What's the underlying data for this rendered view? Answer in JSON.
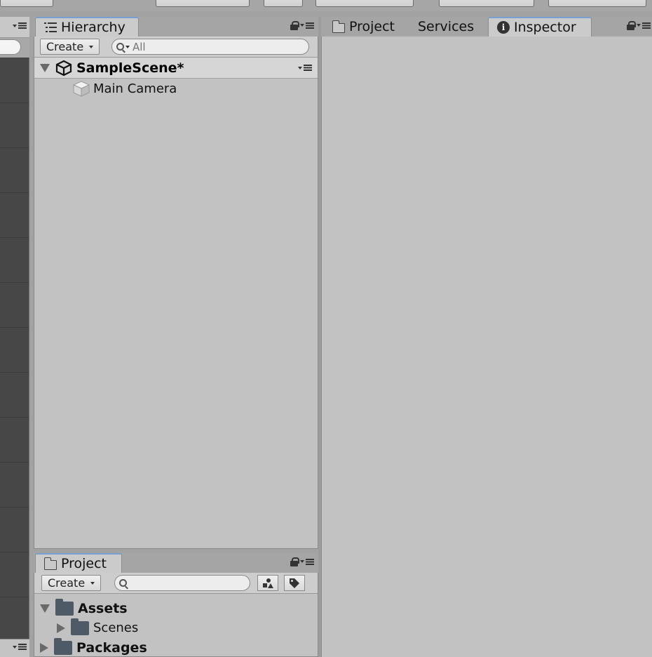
{
  "hierarchy": {
    "tab_label": "Hierarchy",
    "create_label": "Create",
    "search_placeholder": "All",
    "scene_name": "SampleScene*",
    "objects": [
      "Main Camera"
    ]
  },
  "right_panel": {
    "tabs": [
      {
        "label": "Project",
        "icon": "folder-icon"
      },
      {
        "label": "Services",
        "icon": ""
      },
      {
        "label": "Inspector",
        "icon": "info-icon"
      }
    ],
    "info_glyph": "i"
  },
  "project": {
    "tab_label": "Project",
    "create_label": "Create",
    "search_placeholder": "",
    "tree": [
      {
        "label": "Assets",
        "bold": true,
        "expanded": true
      },
      {
        "label": "Scenes",
        "bold": false,
        "expanded": false
      },
      {
        "label": "Packages",
        "bold": true,
        "expanded": false
      }
    ]
  },
  "colors": {
    "panel_bg": "#c2c2c2",
    "scene_view_bg": "#474747",
    "active_tab_accent": "#7a9fd3",
    "folder_dark": "#4e5b66"
  }
}
